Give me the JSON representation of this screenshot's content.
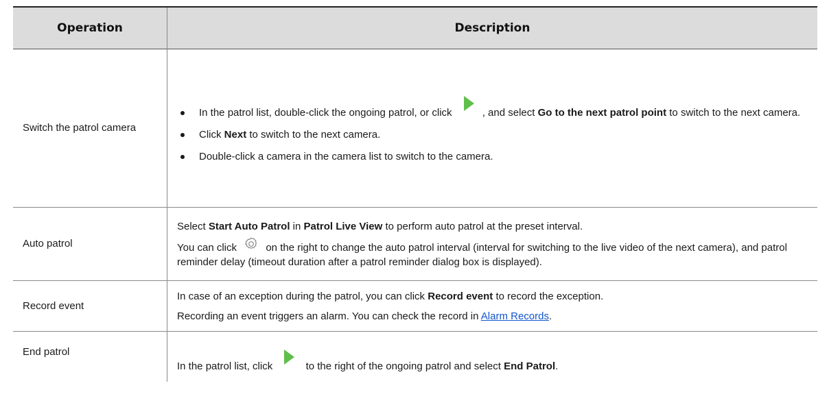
{
  "table": {
    "headers": {
      "operation": "Operation",
      "description": "Description"
    },
    "rows": [
      {
        "operation": "Switch the patrol camera",
        "bullets": [
          {
            "pre": "In the patrol list, double-click the ongoing patrol, or click",
            "mid": ", and select",
            "bold": "Go to the next patrol point",
            "post": "to switch to the next camera."
          },
          {
            "pre": "Click",
            "bold": "Next",
            "post": "to switch to the next camera."
          },
          {
            "text": "Double-click a camera in the camera list to switch to the camera."
          }
        ]
      },
      {
        "operation": "Auto patrol",
        "para1": {
          "pre": "Select",
          "bold1": "Start Auto Patrol",
          "mid": "in",
          "bold2": "Patrol Live View",
          "post": "to perform auto patrol at the preset interval."
        },
        "para2": {
          "pre": "You can click",
          "post": "on the right to change the auto patrol interval (interval for switching to the live video of the next camera), and patrol reminder delay (timeout duration after a patrol reminder dialog box is displayed)."
        }
      },
      {
        "operation": "Record event",
        "para1": {
          "pre": "In case of an exception during the patrol, you can click",
          "bold": "Record event",
          "post": "to record the exception."
        },
        "para2": {
          "pre": "Recording an event triggers an alarm. You can check the record in",
          "link": "Alarm Records",
          "post": "."
        }
      },
      {
        "operation": "End patrol",
        "para": {
          "pre": "In the patrol list, click",
          "mid": "to the right of the ongoing patrol and select",
          "bold": "End Patrol",
          "post": "."
        }
      }
    ]
  },
  "icons": {
    "play": "play-icon",
    "gear": "gear-icon"
  },
  "colors": {
    "header_bg": "#dcdcdc",
    "play_green": "#5fbf4a",
    "link": "#1155cc",
    "gear_gray": "#8a8a8a"
  }
}
